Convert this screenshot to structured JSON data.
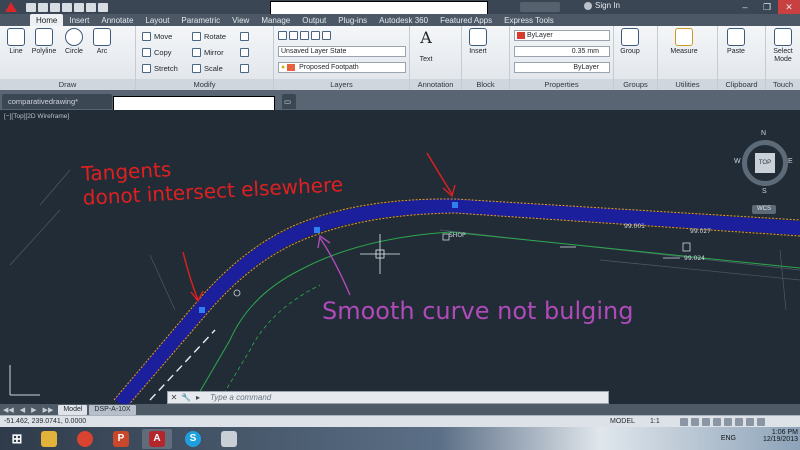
{
  "titlebar": {
    "signin": "Sign In"
  },
  "ribbon": {
    "tabs": [
      "Home",
      "Insert",
      "Annotate",
      "Layout",
      "Parametric",
      "View",
      "Manage",
      "Output",
      "Plug-ins",
      "Autodesk 360",
      "Featured Apps",
      "Express Tools"
    ],
    "draw": {
      "title": "Draw",
      "line": "Line",
      "polyline": "Polyline",
      "circle": "Circle",
      "arc": "Arc"
    },
    "modify": {
      "title": "Modify",
      "move": "Move",
      "copy": "Copy",
      "stretch": "Stretch",
      "rotate": "Rotate",
      "mirror": "Mirror",
      "scale": "Scale"
    },
    "layers": {
      "title": "Layers",
      "state": "Unsaved Layer State",
      "current": "Proposed Footpath",
      "current_color": "#e8603c"
    },
    "annotation": {
      "title": "Annotation",
      "text": "Text"
    },
    "block": {
      "title": "Block",
      "insert": "Insert"
    },
    "properties": {
      "title": "Properties",
      "color": "ByLayer",
      "lineweight": "0.35 mm",
      "linetype": "ByLayer",
      "color_swatch": "#d83a2c"
    },
    "groups": {
      "title": "Groups",
      "group": "Group"
    },
    "utilities": {
      "title": "Utilities",
      "measure": "Measure"
    },
    "clipboard": {
      "title": "Clipboard",
      "paste": "Paste"
    },
    "touch": {
      "title": "Touch",
      "select_mode": "Select Mode"
    }
  },
  "filetab": {
    "name": "comparativedrawing*"
  },
  "viewport": {
    "label": "[−][Top][2D Wireframe]",
    "viewcube": {
      "top": "TOP",
      "n": "N",
      "s": "S",
      "e": "E",
      "w": "W",
      "wcs": "WCS"
    },
    "labels": {
      "shop": "SHOP",
      "lvl1": "99.001",
      "lvl2": "99.027",
      "lvl3": "99.024"
    },
    "annotations": {
      "tangents": "Tangents\ndonot intersect elsewhere",
      "smooth": "Smooth curve not bulging"
    }
  },
  "cmdline": {
    "placeholder": "Type a command"
  },
  "layouttabs": [
    "Model",
    "DSP-A-10X"
  ],
  "statusbar": {
    "coords": "-51.462, 239.0741, 0.0000",
    "model": "MODEL",
    "scale": "1:1"
  },
  "taskbar": {
    "time": "1:06 PM",
    "date": "12/19/2013",
    "lang": "ENG"
  }
}
